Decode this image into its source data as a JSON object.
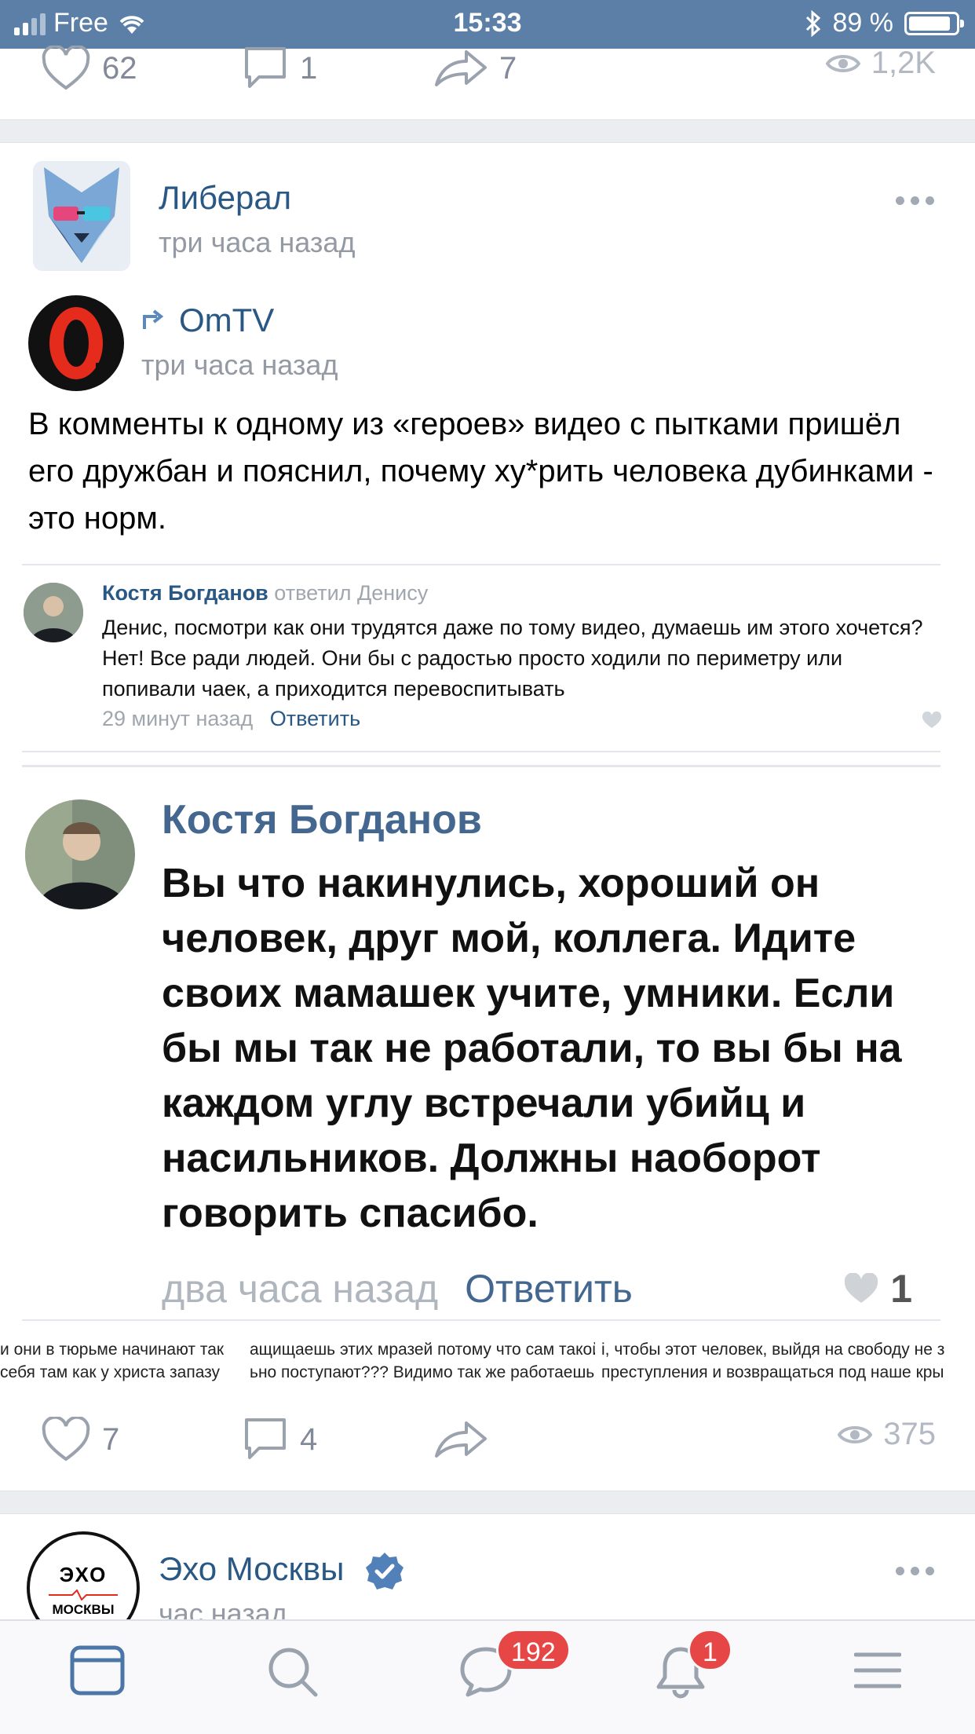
{
  "status_bar": {
    "carrier": "Free",
    "time": "15:33",
    "battery": "89 %"
  },
  "prev_post_actions": {
    "likes": "62",
    "comments": "1",
    "shares": "7",
    "views": "1,2K"
  },
  "post": {
    "author": "Либерал",
    "time": "три часа назад",
    "repost": {
      "author": "OmTV",
      "time": "три часа назад"
    },
    "text": "В комменты к одному из «героев» видео с пытками пришёл его дружбан и пояснил, почему ху*рить человека дубинками - это норм.",
    "image": {
      "comment_small": {
        "name": "Костя Богданов",
        "replied": "ответил Денису",
        "text": "Денис, посмотри как они трудятся даже по тому видео, думаешь им этого хочется? Нет! Все ради людей. Они бы с радостью просто ходили по периметру или попивали чаек, а приходится перевоспитывать",
        "time": "29 минут назад",
        "reply": "Ответить"
      },
      "comment_big": {
        "name": "Костя Богданов",
        "text": "Вы что накинулись, хороший он человек, друг мой, коллега. Идите своих мамашек учите, умники. Если бы мы так не работали, то вы бы на каждом углу встречали убийц и насильников. Должны наоборот говорить спасибо.",
        "time": "два часа назад",
        "reply": "Ответить",
        "likes": "1"
      },
      "cut_left_1": "и они в тюрьме начинают так",
      "cut_left_2": "себя там как у христа запазу",
      "cut_mid_1": "ащищаешь этих мразей потому что сам такой",
      "cut_mid_2": "ьно поступают??? Видимо так же работаешь",
      "cut_right_1": "і, чтобы этот человек, выйдя на свободу не з",
      "cut_right_2": "преступления и возвращаться под наше кры"
    },
    "actions": {
      "likes": "7",
      "comments": "4",
      "views": "375"
    }
  },
  "next_post": {
    "author": "Эхо Москвы",
    "time": "час назад",
    "logo_top": "ЭХО",
    "logo_bottom": "МОСКВЫ"
  },
  "tabbar": {
    "messages_badge": "192",
    "notifications_badge": "1"
  },
  "colors": {
    "accent": "#2a5885",
    "status_bar": "#5b7fa6",
    "badge": "#e64646"
  }
}
